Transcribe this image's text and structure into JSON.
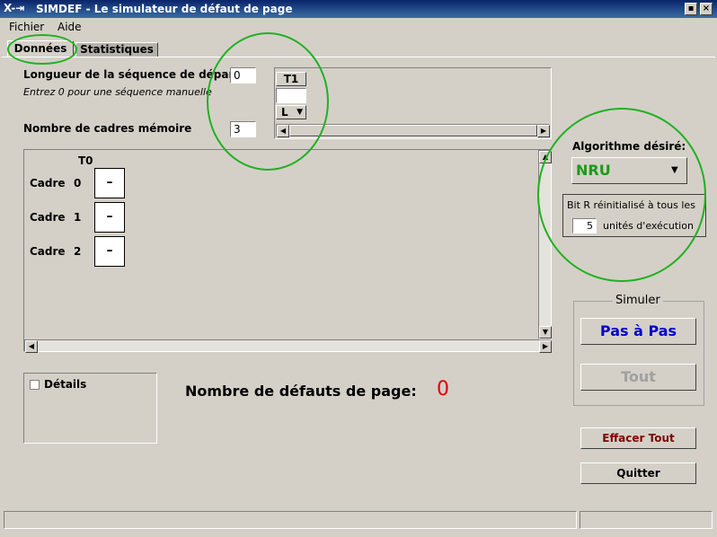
{
  "window": {
    "title": "SIMDEF - Le simulateur de défaut de page",
    "app_icon": "X-⇥",
    "btn_min": "▪",
    "btn_close": "×"
  },
  "menu": [
    "Fichier",
    "Aide"
  ],
  "tabs": [
    "Données",
    "Statistiques"
  ],
  "sequence": {
    "length_label": "Longueur de la séquence de départ",
    "length_value": "0",
    "hint": "Entrez 0 pour une séquence manuelle",
    "frames_label": "Nombre de cadres mémoire",
    "frames_value": "3",
    "t1_label": "T1",
    "t1_value": "",
    "mode_value": "L"
  },
  "frames": {
    "column": "T0",
    "rows": [
      {
        "label": "Cadre",
        "index": "0",
        "value": "–"
      },
      {
        "label": "Cadre",
        "index": "1",
        "value": "–"
      },
      {
        "label": "Cadre",
        "index": "2",
        "value": "–"
      }
    ]
  },
  "algorithm": {
    "label": "Algorithme désiré:",
    "selected": "NRU",
    "bitr_line1": "Bit R réinitialisé à tous les",
    "bitr_value": "5",
    "bitr_line2": "unités d'exécution"
  },
  "simulate": {
    "group_label": "Simuler",
    "step_button": "Pas à Pas",
    "all_button": "Tout"
  },
  "details_label": "Détails",
  "faults": {
    "label": "Nombre de défauts de page:",
    "value": "0"
  },
  "buttons": {
    "clear": "Effacer Tout",
    "quit": "Quitter"
  },
  "colors": {
    "title_bar": "#0a246a",
    "accent_blue": "#0000cc",
    "accent_red": "#e00000",
    "nru_green": "#1a9a1a",
    "annotation_green": "#22b022",
    "clear_text": "#800000"
  }
}
